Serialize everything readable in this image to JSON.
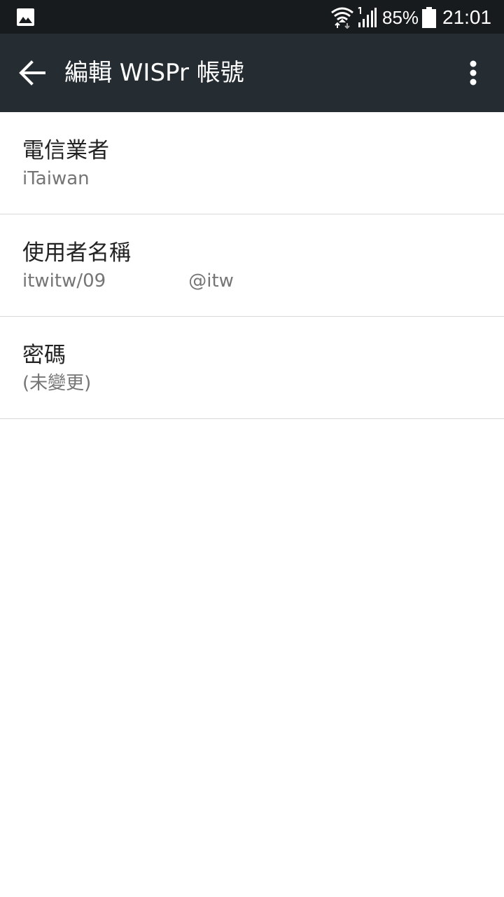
{
  "status_bar": {
    "battery_percent": "85%",
    "time": "21:01",
    "icons": [
      "gallery-icon",
      "wifi-icon",
      "cell-signal-icon",
      "battery-icon"
    ]
  },
  "app_bar": {
    "title": "編輯 WISPr 帳號",
    "back_icon": "arrow-left-icon",
    "more_icon": "more-vertical-icon",
    "background": "#252d33"
  },
  "preferences": [
    {
      "title": "電信業者",
      "summary": "iTaiwan"
    },
    {
      "title": "使用者名稱",
      "summary_prefix": "itwitw/09",
      "summary_suffix": "@itw"
    },
    {
      "title": "密碼",
      "summary": "(未變更)"
    }
  ]
}
